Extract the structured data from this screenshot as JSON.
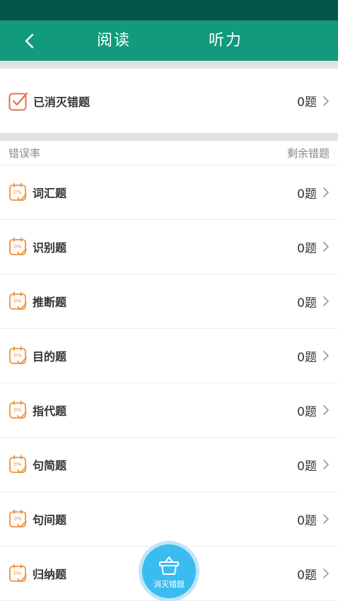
{
  "colors": {
    "status_bar": "#03574a",
    "nav_bar": "#129a7c",
    "accent_orange": "#f0923a",
    "check_red": "#e2704f",
    "fab_blue": "#3bbcf0"
  },
  "nav": {
    "back_icon": "chevron-left-icon",
    "tabs": [
      {
        "label": "阅读"
      },
      {
        "label": "听力"
      }
    ]
  },
  "cleared": {
    "icon": "checkbox-checked-icon",
    "label": "已消灭错题",
    "count": "0题"
  },
  "table_header": {
    "left": "错误率",
    "right": "剩余错题"
  },
  "categories": [
    {
      "icon_text": "0%",
      "label": "词汇题",
      "count": "0题"
    },
    {
      "icon_text": "0%",
      "label": "识别题",
      "count": "0题"
    },
    {
      "icon_text": "0%",
      "label": "推断题",
      "count": "0题"
    },
    {
      "icon_text": "0%",
      "label": "目的题",
      "count": "0题"
    },
    {
      "icon_text": "0%",
      "label": "指代题",
      "count": "0题"
    },
    {
      "icon_text": "0%",
      "label": "句简题",
      "count": "0题"
    },
    {
      "icon_text": "0%",
      "label": "句间题",
      "count": "0题"
    },
    {
      "icon_text": "0%",
      "label": "归纳题",
      "count": "0题"
    }
  ],
  "fab": {
    "icon": "basket-icon",
    "label": "消灭错题"
  }
}
